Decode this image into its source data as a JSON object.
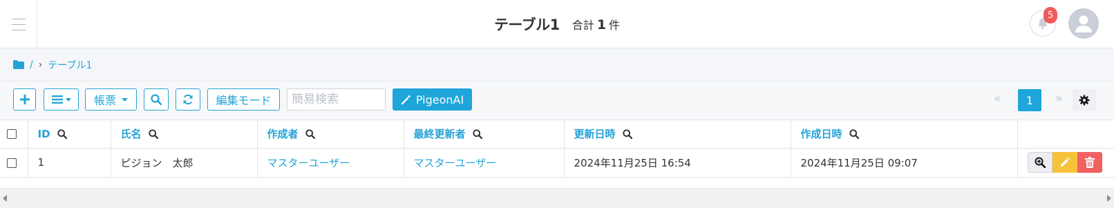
{
  "header": {
    "title": "テーブル1",
    "count_prefix": "合計",
    "count_value": "1",
    "count_suffix": "件",
    "notification_count": "5"
  },
  "breadcrumb": {
    "separator": "/",
    "chevron": "›",
    "current": "テーブル1"
  },
  "toolbar": {
    "report_label": "帳票",
    "edit_mode_label": "編集モード",
    "search_placeholder": "簡易検索",
    "pigeon_ai_label": "PigeonAI",
    "pager_prev": "«",
    "pager_current": "1",
    "pager_next": "»"
  },
  "table": {
    "columns": [
      "ID",
      "氏名",
      "作成者",
      "最終更新者",
      "更新日時",
      "作成日時"
    ],
    "rows": [
      {
        "id": "1",
        "name": "ピジョン　太郎",
        "created_by": "マスターユーザー",
        "updated_by": "マスターユーザー",
        "updated_at": "2024年11月25日 16:54",
        "created_at": "2024年11月25日 09:07"
      }
    ]
  },
  "colors": {
    "accent": "#1ea5da",
    "edit": "#f7c23b",
    "delete": "#f06262",
    "badge": "#f05a5a"
  }
}
